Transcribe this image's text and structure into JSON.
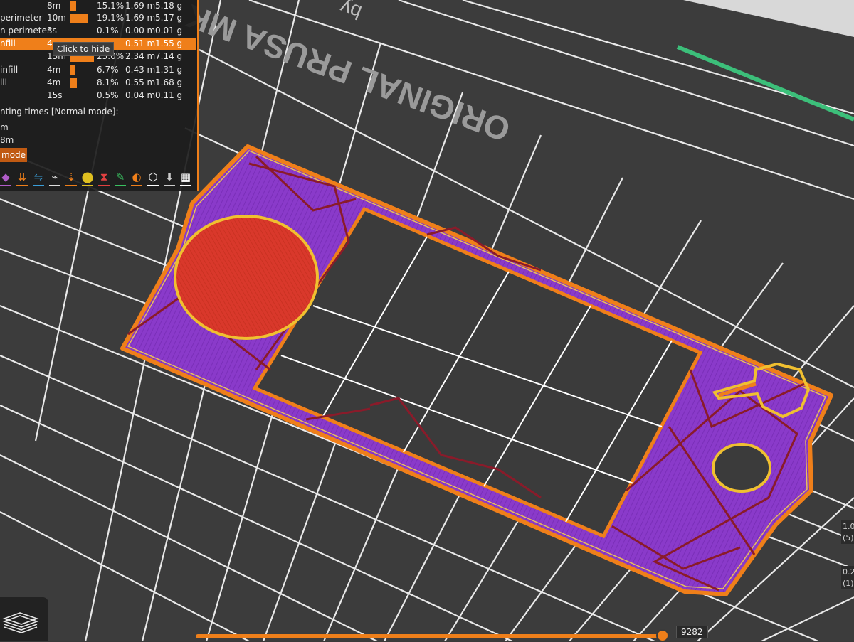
{
  "legend": {
    "rows": [
      {
        "feature": "",
        "time": "8m",
        "percent": "15.1%",
        "length": "1.69 m",
        "weight": "5.18 g",
        "highlighted": false
      },
      {
        "feature": "perimeter",
        "time": "10m",
        "percent": "19.1%",
        "length": "1.69 m",
        "weight": "5.17 g",
        "highlighted": false
      },
      {
        "feature": "n perimeter",
        "time": "3s",
        "percent": "0.1%",
        "length": "0.00 m",
        "weight": "0.01 g",
        "highlighted": false
      },
      {
        "feature": "nfill",
        "time": "4",
        "percent": "",
        "length": "0.51 m",
        "weight": "1.55 g",
        "highlighted": true
      },
      {
        "feature": "",
        "time": "13m",
        "percent": "25.0%",
        "length": "2.34 m",
        "weight": "7.14 g",
        "highlighted": false
      },
      {
        "feature": "infill",
        "time": "4m",
        "percent": "6.7%",
        "length": "0.43 m",
        "weight": "1.31 g",
        "highlighted": false
      },
      {
        "feature": "ill",
        "time": "4m",
        "percent": "8.1%",
        "length": "0.55 m",
        "weight": "1.68 g",
        "highlighted": false
      },
      {
        "feature": "",
        "time": "15s",
        "percent": "0.5%",
        "length": "0.04 m",
        "weight": "0.11 g",
        "highlighted": false
      }
    ],
    "heading": "nting times [Normal mode]:",
    "time_line_1": "m",
    "time_line_2": "8m",
    "mode_button": "mode",
    "tooltip": "Click to hide"
  },
  "toolbar_icons": [
    {
      "name": "feature-types-icon",
      "color": "#b05cc8"
    },
    {
      "name": "travel-icon",
      "color": "#ef7f1a"
    },
    {
      "name": "wipe-icon",
      "color": "#3a9ed8"
    },
    {
      "name": "retractions-icon",
      "color": "#dddddd"
    },
    {
      "name": "deretractions-icon",
      "color": "#ef7f1a"
    },
    {
      "name": "tool-changes-icon",
      "color": "#e0c020"
    },
    {
      "name": "color-changes-icon",
      "color": "#e04040"
    },
    {
      "name": "pause-icon",
      "color": "#3ac060"
    },
    {
      "name": "custom-gcode-icon",
      "color": "#ef7f1a"
    },
    {
      "name": "center-of-gravity-icon",
      "color": "#ffffff"
    },
    {
      "name": "shells-icon",
      "color": "#cccccc"
    },
    {
      "name": "tool-marker-icon",
      "color": "#ffffff"
    }
  ],
  "bed": {
    "logo_text": "ORIGINAL PRUSA MK",
    "logo_sub": "by"
  },
  "right_labels": [
    "1.0",
    "(5)",
    "0.2",
    "(1)"
  ],
  "slider": {
    "value": "9282"
  },
  "colors": {
    "accent": "#ef7f1a",
    "perimeter": "#e8a030",
    "infill": "#8a3aca",
    "solid_infill": "#d9382b",
    "bridge": "#7a1530",
    "bed": "#3a3a3a",
    "grid": "#ffffff",
    "axis": "#3cbf7a"
  }
}
